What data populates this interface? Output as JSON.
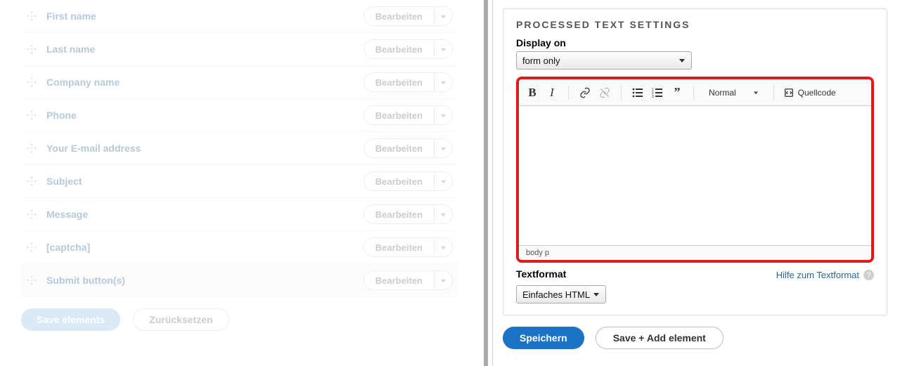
{
  "elements": {
    "items": [
      {
        "label": "First name"
      },
      {
        "label": "Last name"
      },
      {
        "label": "Company name"
      },
      {
        "label": "Phone"
      },
      {
        "label": "Your E-mail address"
      },
      {
        "label": "Subject"
      },
      {
        "label": "Message"
      },
      {
        "label": "[captcha]"
      },
      {
        "label": "Submit button(s)"
      }
    ],
    "edit_label": "Bearbeiten",
    "save_label": "Save elements",
    "reset_label": "Zurücksetzen"
  },
  "settings": {
    "title": "PROCESSED TEXT SETTINGS",
    "display_on_label": "Display on",
    "display_on_value": "form only",
    "editor": {
      "format_label": "Normal",
      "source_label": "Quellcode",
      "status": "body p"
    },
    "textformat_label": "Textformat",
    "textformat_value": "Einfaches HTML",
    "textformat_help": "Hilfe zum Textformat"
  },
  "actions": {
    "save": "Speichern",
    "save_add": "Save + Add element"
  }
}
